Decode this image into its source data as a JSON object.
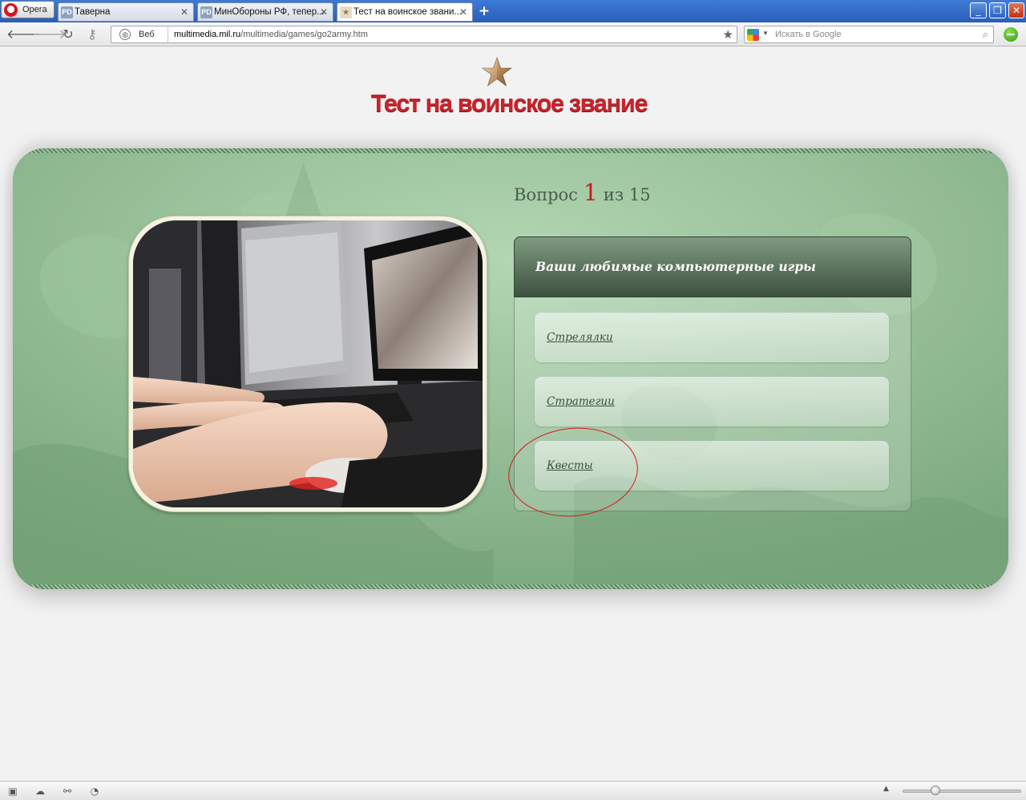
{
  "browser": {
    "menu_label": "Opera",
    "tabs": [
      {
        "label": "Таверна",
        "favicon": "PD",
        "active": false
      },
      {
        "label": "МинОбороны РФ, тепер...",
        "favicon": "PD",
        "active": false
      },
      {
        "label": "Тест на воинское звани...",
        "favicon": "star",
        "active": true
      }
    ],
    "address": {
      "mode_label": "Веб",
      "url_host": "multimedia.mil.ru",
      "url_path": "/multimedia/games/go2army.htm"
    },
    "search": {
      "placeholder": "Искать в Google"
    }
  },
  "page": {
    "title": "Тест на воинское звание",
    "question": {
      "prefix": "Вопрос",
      "current": "1",
      "separator": "из",
      "total": "15",
      "text": "Ваши любимые компьютерные игры"
    },
    "answers": [
      {
        "label": "Стрелялки"
      },
      {
        "label": "Стратегии"
      },
      {
        "label": "Квесты",
        "highlighted": true
      }
    ]
  },
  "statusbar": {
    "zoom_level": 0.28
  },
  "colors": {
    "title_red": "#c8232c",
    "panel_green": "#8dba8f",
    "header_dark_green": "#3d513f",
    "annotation_red": "#d41a1a"
  }
}
